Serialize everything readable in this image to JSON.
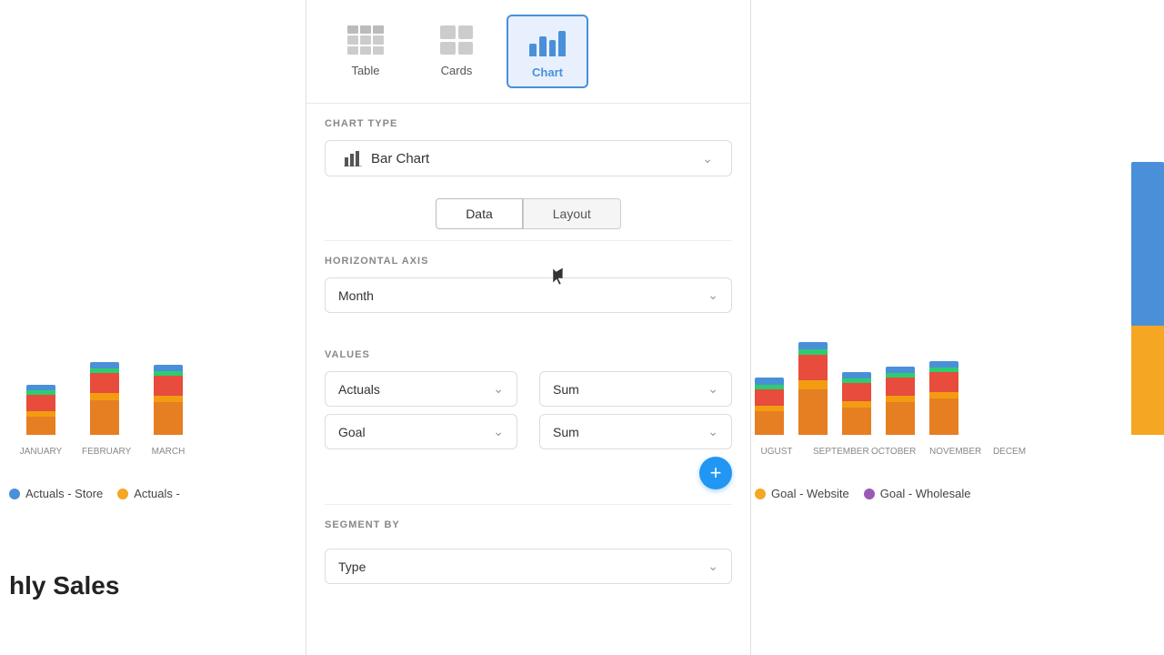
{
  "views": [
    {
      "id": "table",
      "label": "Table",
      "active": false
    },
    {
      "id": "cards",
      "label": "Cards",
      "active": false
    },
    {
      "id": "chart",
      "label": "Chart",
      "active": true
    }
  ],
  "chart_type_section": "CHART TYPE",
  "chart_type_label": "Bar Chart",
  "sub_tabs": [
    {
      "id": "data",
      "label": "Data",
      "active": true
    },
    {
      "id": "layout",
      "label": "Layout",
      "active": false
    }
  ],
  "horizontal_axis_label": "HORIZONTAL AXIS",
  "horizontal_axis_value": "Month",
  "values_label": "VALUES",
  "values": [
    {
      "field": "Actuals",
      "agg": "Sum"
    },
    {
      "field": "Goal",
      "agg": "Sum"
    }
  ],
  "segment_by_label": "SEGMENT BY",
  "segment_by_value": "Type",
  "add_button_label": "+",
  "legend": [
    {
      "label": "Actuals - Store",
      "color": "#4a90d9"
    },
    {
      "label": "Actuals -",
      "color": "#f5a623"
    },
    {
      "label": "Goal - Website",
      "color": "#f5a623"
    },
    {
      "label": "Goal - Wholesale",
      "color": "#9b59b6"
    }
  ],
  "months_left": [
    "JANUARY",
    "FEBRUARY",
    "MARCH"
  ],
  "months_right": [
    "UGUST",
    "SEPTEMBER",
    "OCTOBER",
    "NOVEMBER",
    "DECEM"
  ],
  "chart_title": "hly Sales"
}
